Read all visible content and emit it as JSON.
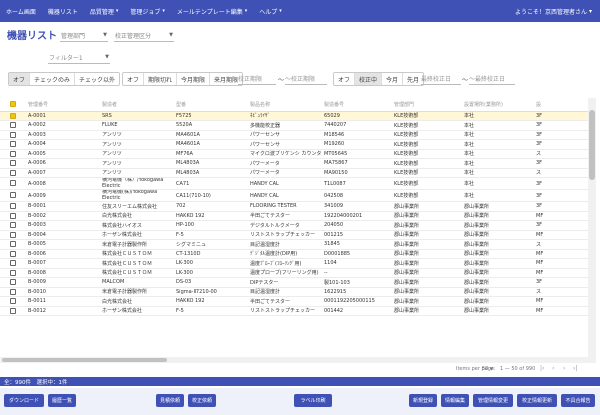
{
  "nav": {
    "items": [
      {
        "label": "ホーム画面",
        "has_menu": false
      },
      {
        "label": "機器リスト",
        "has_menu": false
      },
      {
        "label": "品質管理",
        "has_menu": true
      },
      {
        "label": "管理ジョブ",
        "has_menu": true
      },
      {
        "label": "メールテンプレート編集",
        "has_menu": true
      },
      {
        "label": "ヘルプ",
        "has_menu": true
      }
    ],
    "user_greeting": "ようこそ！京西管理者さん",
    "accent_color": "#3f51b5"
  },
  "page": {
    "title": "機器リスト"
  },
  "filters": {
    "dept_placeholder": "管理部門",
    "calib_class_placeholder": "校正管理区分",
    "filter_placeholder": "フィルター1",
    "group1": [
      "オフ",
      "チェックのみ",
      "チェック以外"
    ],
    "group2": [
      "オフ",
      "期限切れ",
      "今月期限",
      "来月期限"
    ],
    "date1_from": "校正期限",
    "date1_to": "〜校正期限",
    "tilde": "〜",
    "group3": [
      "オフ",
      "校正中",
      "今月",
      "先月"
    ],
    "date2_from": "最終校正日",
    "date2_to": "〜最終校正日"
  },
  "table": {
    "columns": [
      "",
      "管理番号",
      "製造者",
      "型番",
      "製品名称",
      "製造番号",
      "管理部門",
      "設置場所(業務所)",
      "設"
    ],
    "rows": [
      {
        "checked": true,
        "cells": [
          "A-0001",
          "SRS",
          "F5725",
          "ﾈﾋﾞｭﾗｲｻﾞ",
          "65029",
          "KLE技術部",
          "本社",
          "3F"
        ]
      },
      {
        "checked": false,
        "cells": [
          "A-0002",
          "FLUKE",
          "5520A",
          "多機能校正器",
          "7440207",
          "KLE技術部",
          "本社",
          "3F"
        ]
      },
      {
        "checked": false,
        "cells": [
          "A-0003",
          "アンリツ",
          "MA4601A",
          "パワーセンサ",
          "M18546",
          "KLE技術部",
          "本社",
          "3F"
        ]
      },
      {
        "checked": false,
        "cells": [
          "A-0004",
          "アンリツ",
          "MA4601A",
          "パワーセンサ",
          "M19260",
          "KLE技術部",
          "本社",
          "3F"
        ]
      },
      {
        "checked": false,
        "cells": [
          "A-0005",
          "アンリツ",
          "MF76A",
          "マイクロ波ブリケンシ カウンタ",
          "MT05645",
          "KLE技術部",
          "本社",
          "ス"
        ]
      },
      {
        "checked": false,
        "cells": [
          "A-0006",
          "アンリツ",
          "ML4803A",
          "パワーメータ",
          "MA75867",
          "KLE技術部",
          "本社",
          "3F"
        ]
      },
      {
        "checked": false,
        "cells": [
          "A-0007",
          "アンリツ",
          "ML4803A",
          "パワーメータ",
          "MA90150",
          "KLE技術部",
          "本社",
          "ス"
        ]
      },
      {
        "checked": false,
        "cells": [
          "A-0008",
          "横河電機（株）/Yokogawa Electric",
          "CA71",
          "HANDY CAL",
          "T1L0087",
          "KLE技術部",
          "本社",
          "3F"
        ]
      },
      {
        "checked": false,
        "cells": [
          "A-0009",
          "横河電機(株)/Yokogawa Electric",
          "CA11(710-10)",
          "HANDY CAL",
          "042508",
          "KLE技術部",
          "本社",
          "3F"
        ]
      },
      {
        "checked": false,
        "cells": [
          "B-0001",
          "住友スリーエム株式会社",
          "702",
          "FLOORING TESTER",
          "341009",
          "郡山事業所",
          "郡山事業所",
          "3F"
        ]
      },
      {
        "checked": false,
        "cells": [
          "B-0002",
          "白光株式会社",
          "HAKKO 192",
          "半田ごてテスター",
          "192204000201",
          "郡山事業所",
          "郡山事業所",
          "MF"
        ]
      },
      {
        "checked": false,
        "cells": [
          "B-0003",
          "株式会社ハイオス",
          "HP-100",
          "デジタルトルクメータ",
          "204050",
          "郡山事業所",
          "郡山事業所",
          "3F"
        ]
      },
      {
        "checked": false,
        "cells": [
          "B-0004",
          "ホーザン株式会社",
          "F-5",
          "リストストラップチェッカー",
          "001215",
          "郡山事業所",
          "郡山事業所",
          "MF"
        ]
      },
      {
        "checked": false,
        "cells": [
          "B-0005",
          "米倉電子計器製作所",
          "シグマミニュ",
          "目記温湿度計",
          "31845",
          "郡山事業所",
          "郡山事業所",
          "ス"
        ]
      },
      {
        "checked": false,
        "cells": [
          "B-0006",
          "株式会社ＣＵＳＴＯＭ",
          "CT-1310D",
          "ﾃﾞｼﾞﾀﾙ温度計(DIP用)",
          "D0001885",
          "郡山事業所",
          "郡山事業所",
          "MF"
        ]
      },
      {
        "checked": false,
        "cells": [
          "B-0007",
          "株式会社ＣＵＳＴＯＭ",
          "LK-300",
          "温度ﾌﾟﾛｰﾌﾞ(ﾌﾛｰﾘﾝｸﾞ用)",
          "1104",
          "郡山事業所",
          "郡山事業所",
          "MF"
        ]
      },
      {
        "checked": false,
        "cells": [
          "B-0008",
          "株式会社ＣＵＳＴＯＭ",
          "LK-300",
          "温度プローブ(フリーリング用)",
          "--",
          "郡山事業所",
          "郡山事業所",
          "MF"
        ]
      },
      {
        "checked": false,
        "cells": [
          "B-0009",
          "MALCOM",
          "DS-03",
          "DIPテスター",
          "製101-103",
          "郡山事業所",
          "郡山事業所",
          "3F"
        ]
      },
      {
        "checked": false,
        "cells": [
          "B-0010",
          "米倉電子計器製作所",
          "Sigma-Ⅱ7210-00",
          "目記温湿度計",
          "1622915",
          "郡山事業所",
          "郡山事業所",
          "ス"
        ]
      },
      {
        "checked": false,
        "cells": [
          "B-0011",
          "白光株式会社",
          "HAKKO 192",
          "半田ごてテスター",
          "0001192205000115",
          "郡山事業所",
          "郡山事業所",
          "MF"
        ]
      },
      {
        "checked": false,
        "cells": [
          "B-0012",
          "ホーザン株式会社",
          "F-5",
          "リストストラップチェッカー",
          "001442",
          "郡山事業所",
          "郡山事業所",
          "MF"
        ]
      }
    ]
  },
  "pager": {
    "items_per_page_label": "Items per page:",
    "items_per_page": "50",
    "range": "1 — 50 of 990"
  },
  "status": {
    "text": "全：990件　選択中：1件"
  },
  "buttons": {
    "download": "ダウンロード",
    "history": "履歴一覧",
    "calib_request": "見積依頼",
    "calib_order": "校正依頼",
    "label_print": "ラベル印刷",
    "new_register": "新規登録",
    "info_edit": "情報編集",
    "mgmt_change": "管理情報変更",
    "calib_info_edit": "校正情報更新",
    "defect_contact": "不具合報告"
  }
}
